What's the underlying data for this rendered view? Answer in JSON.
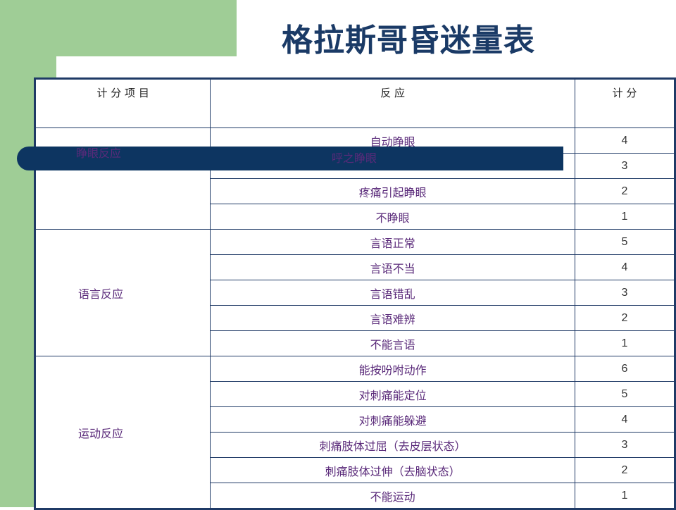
{
  "title": "格拉斯哥昏迷量表",
  "header": {
    "item": "计 分 项 目",
    "response": "反    应",
    "score": "计     分"
  },
  "sections": [
    {
      "category": "睁眼反应",
      "rows": [
        {
          "response": "自动睁眼",
          "score": "4"
        },
        {
          "response": "呼之睁眼",
          "score": "3"
        },
        {
          "response": "疼痛引起睁眼",
          "score": "2"
        },
        {
          "response": "不睁眼",
          "score": "1"
        }
      ]
    },
    {
      "category": "语言反应",
      "rows": [
        {
          "response": "言语正常",
          "score": "5"
        },
        {
          "response": "言语不当",
          "score": "4"
        },
        {
          "response": "言语错乱",
          "score": "3"
        },
        {
          "response": "言语难辨",
          "score": "2"
        },
        {
          "response": "不能言语",
          "score": "1"
        }
      ]
    },
    {
      "category": "运动反应",
      "rows": [
        {
          "response": "能按吩咐动作",
          "score": "6"
        },
        {
          "response": "对刺痛能定位",
          "score": "5"
        },
        {
          "response": "对刺痛能躲避",
          "score": "4"
        },
        {
          "response": "刺痛肢体过屈（去皮层状态）",
          "score": "3"
        },
        {
          "response": "刺痛肢体过伸（去脑状态）",
          "score": "2"
        },
        {
          "response": "不能运动",
          "score": "1"
        }
      ]
    }
  ],
  "colors": {
    "green": "#9fcd96",
    "navy": "#0d3561",
    "title": "#1a3a66",
    "text_purple": "#5a2a7a"
  }
}
